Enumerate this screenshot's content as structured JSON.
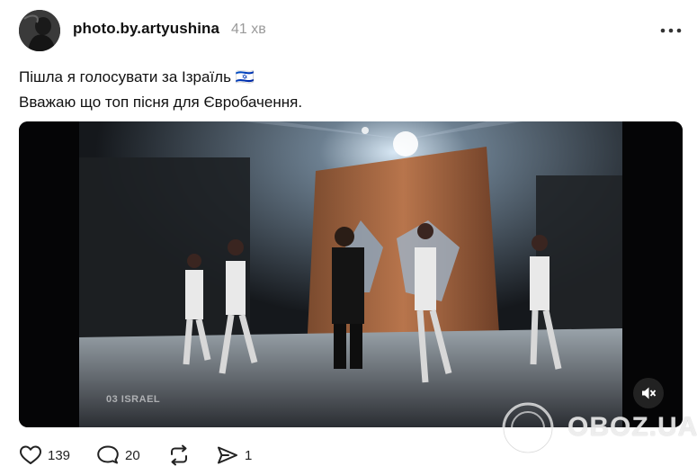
{
  "post": {
    "username": "photo.by.artyushina",
    "time": "41 хв",
    "text_line1": "Пішла я голосувати за Ізраїль 🇮🇱",
    "text_line2": "Вважаю що топ пісня для Євробачення.",
    "video": {
      "overlay_label": "03 ISRAEL",
      "muted": true
    },
    "actions": {
      "likes": "139",
      "replies": "20",
      "shares": "1"
    },
    "icons": {
      "more": "more-horizontal-icon",
      "like": "heart-icon",
      "reply": "comment-bubble-icon",
      "repost": "repost-icon",
      "share": "send-icon",
      "mute": "speaker-muted-icon"
    }
  },
  "watermark": {
    "text": "OBOZ.UA"
  },
  "colors": {
    "text": "#111111",
    "muted_text": "#9a9a9a",
    "background": "#ffffff",
    "video_bg": "#0b0b0d"
  }
}
